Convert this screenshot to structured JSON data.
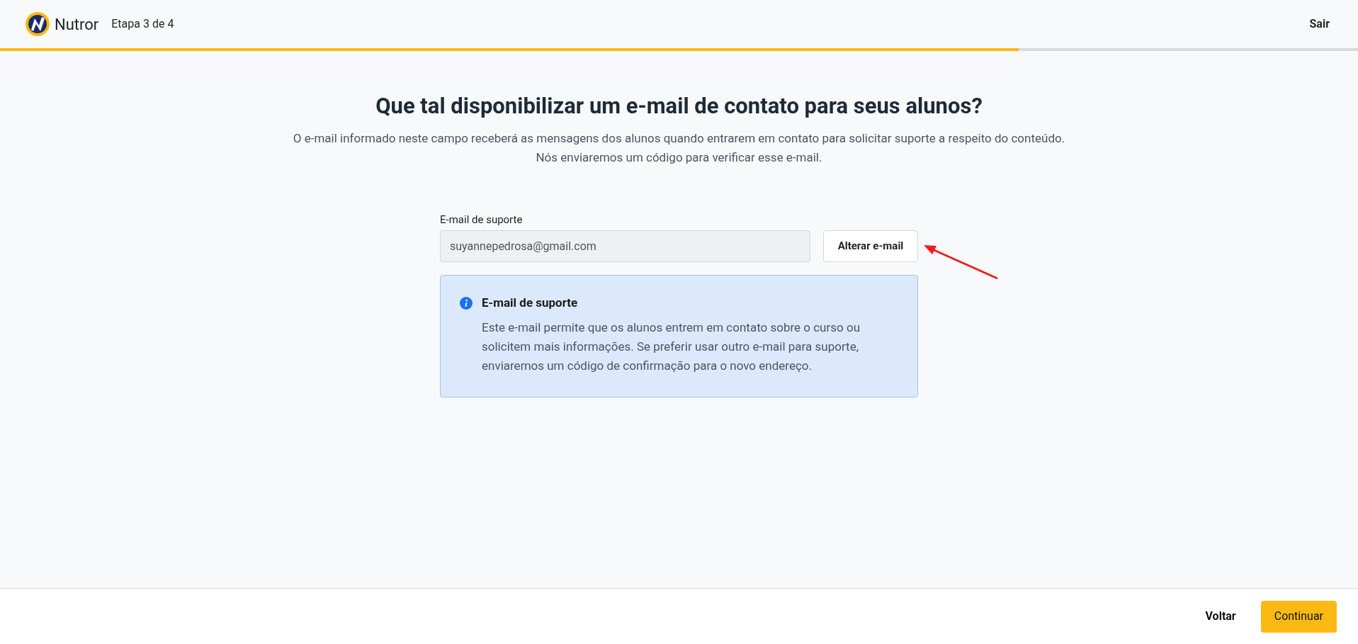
{
  "header": {
    "brand": "Nutror",
    "step": "Etapa 3 de 4",
    "exit": "Sair"
  },
  "progress": {
    "level": 0.75
  },
  "title": "Que tal disponibilizar um e-mail de contato para seus alunos?",
  "subtitle": [
    "O e-mail informado neste campo receberá as mensagens dos alunos quando entrarem em contato para solicitar suporte a respeito do conteúdo.",
    "Nós enviaremos um código para verificar esse e-mail."
  ],
  "field": {
    "label": "E-mail de suporte",
    "value": "suyannepedrosa@gmail.com",
    "disabled": true
  },
  "change_button": "Alterar e-mail",
  "info": {
    "title": "E-mail de suporte",
    "text": "Este e-mail permite que os alunos entrem em contato sobre o curso ou solicitem mais informações. Se preferir usar outro e-mail para suporte, enviaremos um código de confirmação para o novo endereço."
  },
  "footer": {
    "back": "Voltar",
    "continue": "Continuar"
  }
}
